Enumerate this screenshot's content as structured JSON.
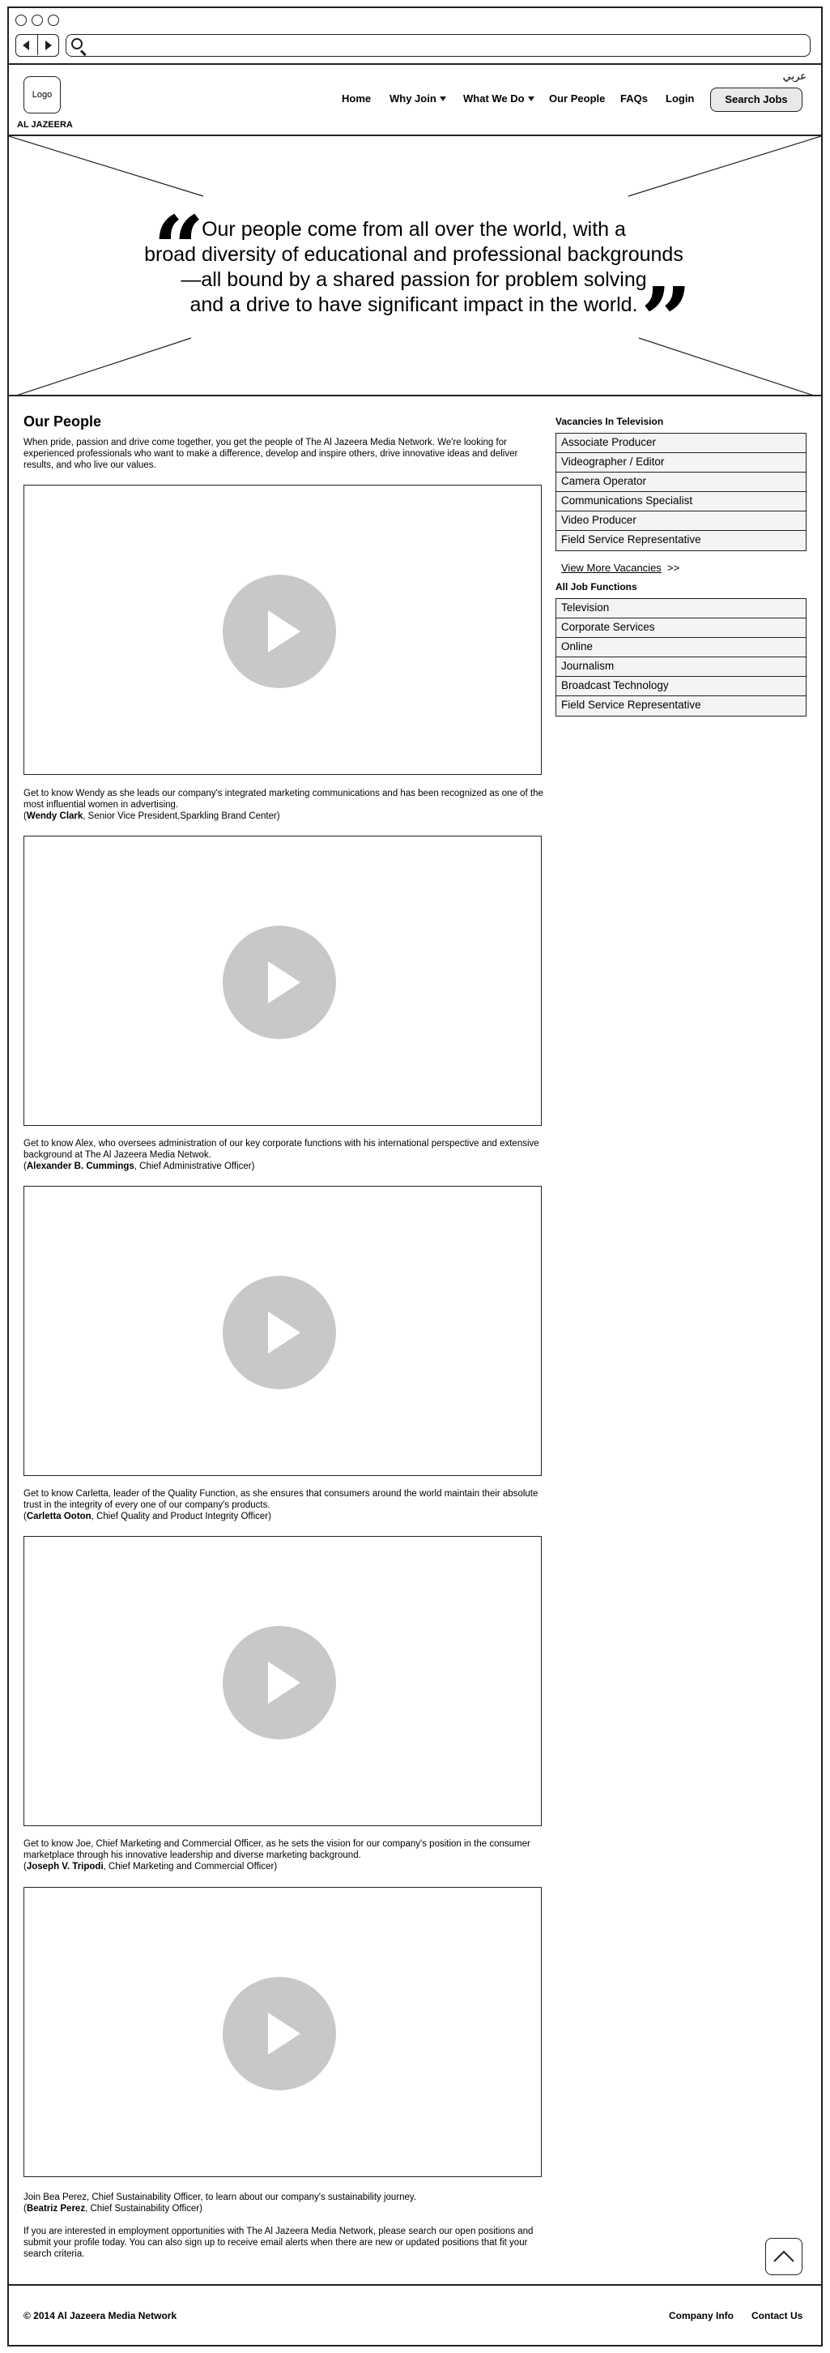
{
  "header": {
    "language": "عربي",
    "logo_text": "Logo",
    "brand": "AL JAZEERA",
    "nav": {
      "home": "Home",
      "why_join": "Why Join",
      "what_we_do": "What We Do",
      "our_people": "Our People",
      "faqs": "FAQs",
      "login": "Login"
    },
    "search_jobs": "Search Jobs"
  },
  "hero": {
    "quote_lines": [
      "Our people come from all over the world, with a",
      "broad diversity of educational and professional backgrounds",
      "—all bound by a shared passion for problem solving",
      "and a drive to have significant impact in the world."
    ]
  },
  "main": {
    "title": "Our People",
    "intro": "When pride, passion and drive come together, you get the people of The Al Jazeera Media Network. We're looking for experienced professionals who want to make a difference, develop and inspire others, drive innovative ideas and deliver results, and who live our values.",
    "people": [
      {
        "text": "Get to know Wendy as she leads our company's integrated marketing communications and has been recognized as one of the most influential women in advertising.",
        "name": "Wendy Clark",
        "role": ", Senior Vice President,Sparkling Brand Center)"
      },
      {
        "text": "Get to know Alex, who oversees administration of our key corporate functions with his international perspective and extensive background at The Al Jazeera Media Netwok.",
        "name": "Alexander B. Cummings",
        "role": ", Chief Administrative Officer)"
      },
      {
        "text": "Get to know Carletta, leader of the Quality Function, as she ensures that consumers around the world maintain their absolute trust in the integrity of every one of our company's products.",
        "name": "Carletta Ooton",
        "role": ", Chief Quality and Product Integrity Officer)"
      },
      {
        "text": "Get to know Joe, Chief Marketing and Commercial Officer, as he sets the vision for our company's position in the consumer marketplace through his innovative leadership and diverse marketing background.",
        "name": "Joseph V. Tripodi",
        "role": ", Chief Marketing and Commercial Officer)"
      },
      {
        "text": "Join Bea Perez, Chief Sustainability Officer, to learn about our company's sustainability journey.",
        "name": "Beatriz Perez",
        "role": ", Chief Sustainability Officer)"
      }
    ],
    "closing": "If you are interested in employment opportunities with The Al Jazeera Media Network, please search our open positions and submit your profile today. You can also sign up to receive email alerts when there are new or updated positions that fit your search criteria."
  },
  "sidebar": {
    "vacancies_title": "Vacancies In Television",
    "vacancies": [
      "Associate Producer",
      "Videographer / Editor",
      "Camera Operator",
      "Communications Specialist",
      "Video Producer",
      "Field Service Representative"
    ],
    "view_more": "View More Vacancies",
    "view_more_suffix": ">>",
    "functions_title": "All Job Functions",
    "functions": [
      "Television",
      "Corporate Services",
      "Online",
      "Journalism",
      "Broadcast Technology",
      "Field Service Representative"
    ]
  },
  "footer": {
    "copyright": "© 2014 Al Jazeera Media Network",
    "company_info": "Company Info",
    "contact_us": "Contact Us"
  }
}
